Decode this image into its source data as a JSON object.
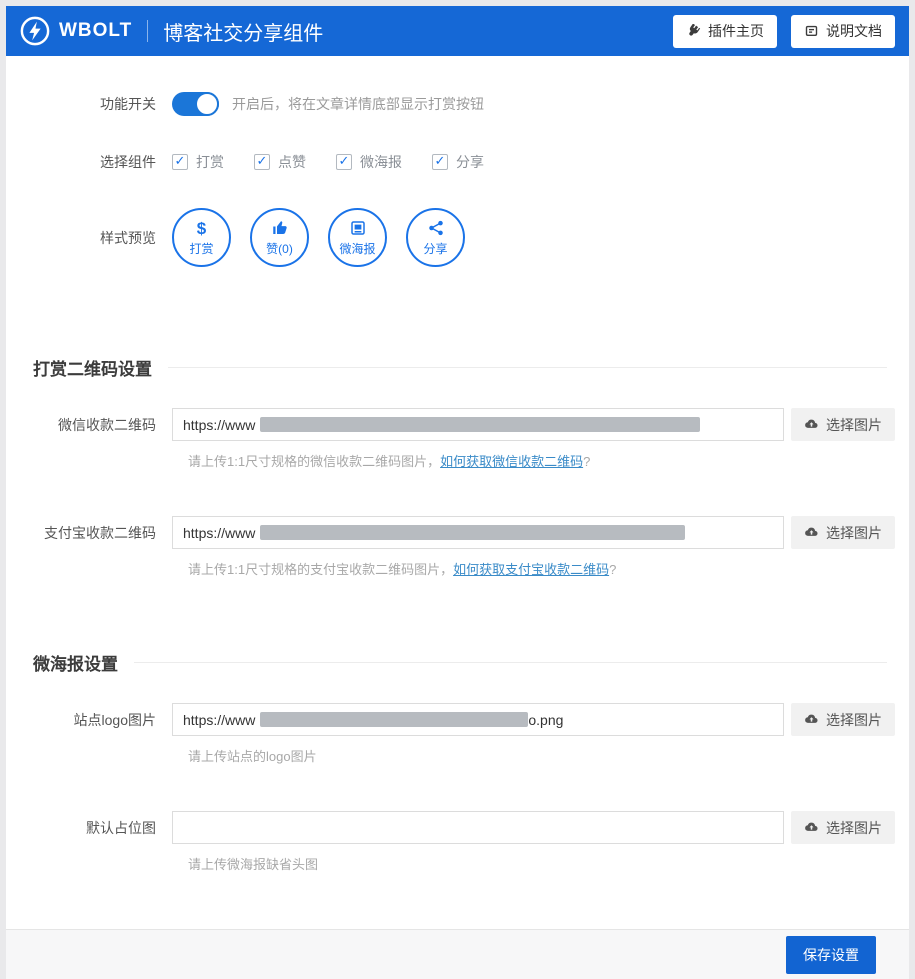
{
  "theme": {
    "header_blue": "#1568d6",
    "accent_blue": "#1a73e8",
    "link_blue": "#3a8bc8",
    "save_blue": "#1264d2",
    "redaction_gray": "#b7bbc0"
  },
  "header": {
    "brand": "WBOLT",
    "title": "博客社交分享组件",
    "buttons": [
      {
        "icon": "plug-icon",
        "label": "插件主页"
      },
      {
        "icon": "doc-icon",
        "label": "说明文档"
      }
    ]
  },
  "form": {
    "feature_switch": {
      "label": "功能开关",
      "state": "on",
      "description": "开启后，将在文章详情底部显示打赏按钮"
    },
    "components": {
      "label": "选择组件",
      "options": [
        {
          "label": "打赏",
          "checked": true
        },
        {
          "label": "点赞",
          "checked": true
        },
        {
          "label": "微海报",
          "checked": true
        },
        {
          "label": "分享",
          "checked": true
        }
      ]
    },
    "preview": {
      "label": "样式预览",
      "items": [
        {
          "icon": "dollar-icon",
          "label": "打赏"
        },
        {
          "icon": "thumb-up-icon",
          "label": "赞(0)"
        },
        {
          "icon": "poster-icon",
          "label": "微海报"
        },
        {
          "icon": "share-icon",
          "label": "分享"
        }
      ]
    },
    "sections": [
      {
        "title": "打赏二维码设置",
        "rows": [
          {
            "label": "微信收款二维码",
            "value_prefix": "https://www",
            "value_redacted": true,
            "button_label": "选择图片",
            "help": {
              "text": "请上传1:1尺寸规格的微信收款二维码图片，",
              "link": "如何获取微信收款二维码",
              "suffix": "?"
            }
          },
          {
            "label": "支付宝收款二维码",
            "value_prefix": "https://www",
            "value_redacted": true,
            "button_label": "选择图片",
            "help": {
              "text": "请上传1:1尺寸规格的支付宝收款二维码图片，",
              "link": "如何获取支付宝收款二维码",
              "suffix": "?"
            }
          }
        ]
      },
      {
        "title": "微海报设置",
        "rows": [
          {
            "label": "站点logo图片",
            "value_prefix": "https://www",
            "value_redacted": true,
            "value_suffix": "o.png",
            "button_label": "选择图片",
            "help": {
              "text": "请上传站点的logo图片"
            }
          },
          {
            "label": "默认占位图",
            "value_prefix": "",
            "value_redacted": false,
            "button_label": "选择图片",
            "help": {
              "text": "请上传微海报缺省头图"
            }
          }
        ]
      }
    ],
    "footer": {
      "save_label": "保存设置"
    }
  }
}
